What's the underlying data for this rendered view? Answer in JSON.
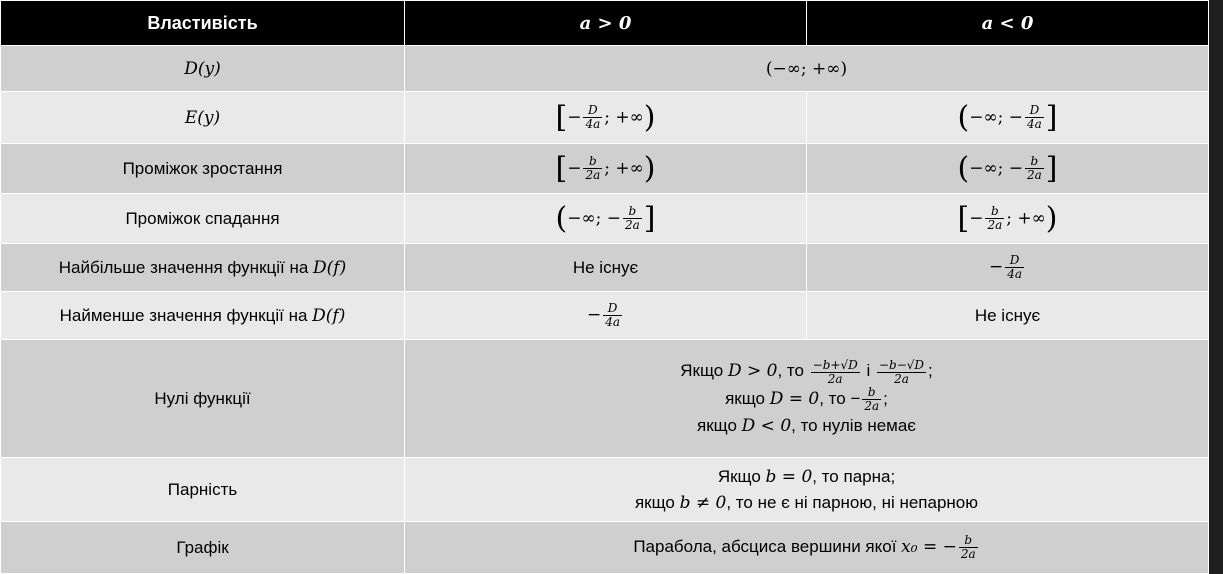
{
  "header": {
    "col1": "Властивість",
    "col2": "a > 0",
    "col3": "a < 0"
  },
  "rows": {
    "domain": {
      "label": "D(y)",
      "value": "(−∞; +∞)"
    },
    "range": {
      "label": "E(y)",
      "pos_open": "[",
      "pos_neg": "−",
      "pos_num": "D",
      "pos_den": "4a",
      "pos_tail": "; +∞",
      "pos_close": ")",
      "neg_open": "(",
      "neg_head": "−∞; −",
      "neg_num": "D",
      "neg_den": "4a",
      "neg_close": "]"
    },
    "increase": {
      "label": "Проміжок зростання",
      "pos_num": "b",
      "pos_den": "2a",
      "neg_num": "b",
      "neg_den": "2a"
    },
    "decrease": {
      "label": "Проміжок спадання",
      "pos_num": "b",
      "pos_den": "2a",
      "neg_num": "b",
      "neg_den": "2a"
    },
    "max": {
      "label_text": "Найбільше значення функції на ",
      "label_math": "D(f)",
      "pos": "Не існує",
      "neg_num": "D",
      "neg_den": "4a"
    },
    "min": {
      "label_text": "Найменше значення функції на ",
      "label_math": "D(f)",
      "pos_num": "D",
      "pos_den": "4a",
      "neg": "Не існує"
    },
    "zeros": {
      "label": "Нулі функції",
      "line1_a": "Якщо ",
      "line1_m": "D > 0",
      "line1_b": ", то ",
      "line1_n1": "−b+√D",
      "line1_d1": "2a",
      "line1_c": " і ",
      "line1_n2": "−b−√D",
      "line1_d2": "2a",
      "line1_end": ";",
      "line2_a": "якщо ",
      "line2_m": "D = 0",
      "line2_b": ", то −",
      "line2_n": "b",
      "line2_d": "2a",
      "line2_end": ";",
      "line3_a": "якщо ",
      "line3_m": "D < 0",
      "line3_b": ", то нулів немає"
    },
    "parity": {
      "label": "Парність",
      "line1_a": "Якщо ",
      "line1_m": "b = 0",
      "line1_b": ", то парна;",
      "line2_a": "якщо ",
      "line2_m": "b ≠ 0",
      "line2_b": ", то не є ні парною, ні непарною"
    },
    "graph": {
      "label": "Графік",
      "text": "Парабола, абсциса вершини якої ",
      "math": "x₀ = −",
      "num": "b",
      "den": "2a"
    }
  }
}
